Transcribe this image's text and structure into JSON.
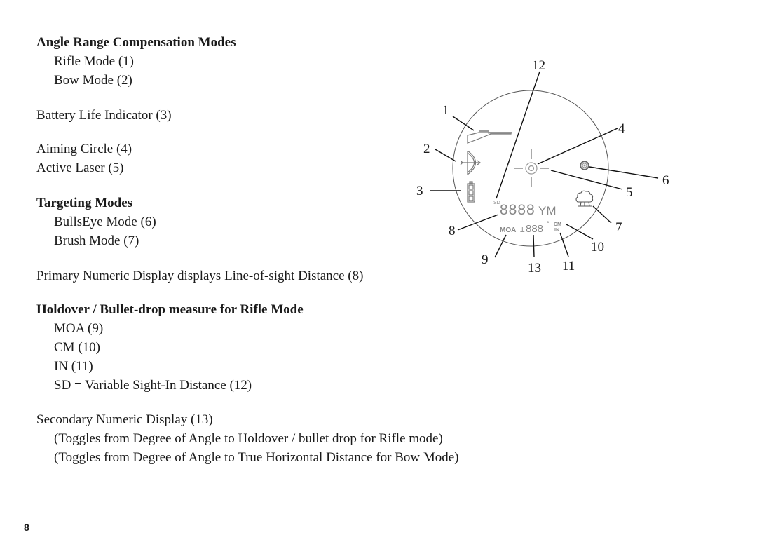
{
  "sections": {
    "arc": {
      "heading": "Angle Range Compensation Modes",
      "items": [
        "Rifle Mode (1)",
        "Bow Mode (2)"
      ]
    },
    "battery": "Battery Life Indicator (3)",
    "aiming_circle": "Aiming Circle (4)",
    "active_laser": "Active Laser (5)",
    "targeting": {
      "heading": "Targeting Modes",
      "items": [
        "BullsEye Mode (6)",
        "Brush Mode (7)"
      ]
    },
    "primary_display": "Primary Numeric Display displays Line-of-sight Distance (8)",
    "holdover": {
      "heading": "Holdover / Bullet-drop measure for Rifle Mode",
      "items": [
        "MOA (9)",
        "CM (10)",
        "IN (11)",
        "SD = Variable Sight-In Distance (12)"
      ]
    },
    "secondary_display": {
      "label": "Secondary Numeric Display (13)",
      "notes": [
        "(Toggles from Degree of Angle to Holdover / bullet drop for Rifle mode)",
        "(Toggles from Degree of Angle to True Horizontal Distance for Bow Mode)"
      ]
    }
  },
  "diagram": {
    "callouts": [
      "1",
      "2",
      "3",
      "4",
      "5",
      "6",
      "7",
      "8",
      "9",
      "10",
      "11",
      "12",
      "13"
    ],
    "lcd": {
      "sd": "SD",
      "primary_digits": "8888",
      "units": "YM",
      "moa": "MOA",
      "secondary_sign": "±",
      "secondary_digits": "888",
      "degree": "°",
      "cm": "CM",
      "in": "IN"
    }
  },
  "page_number": "8"
}
